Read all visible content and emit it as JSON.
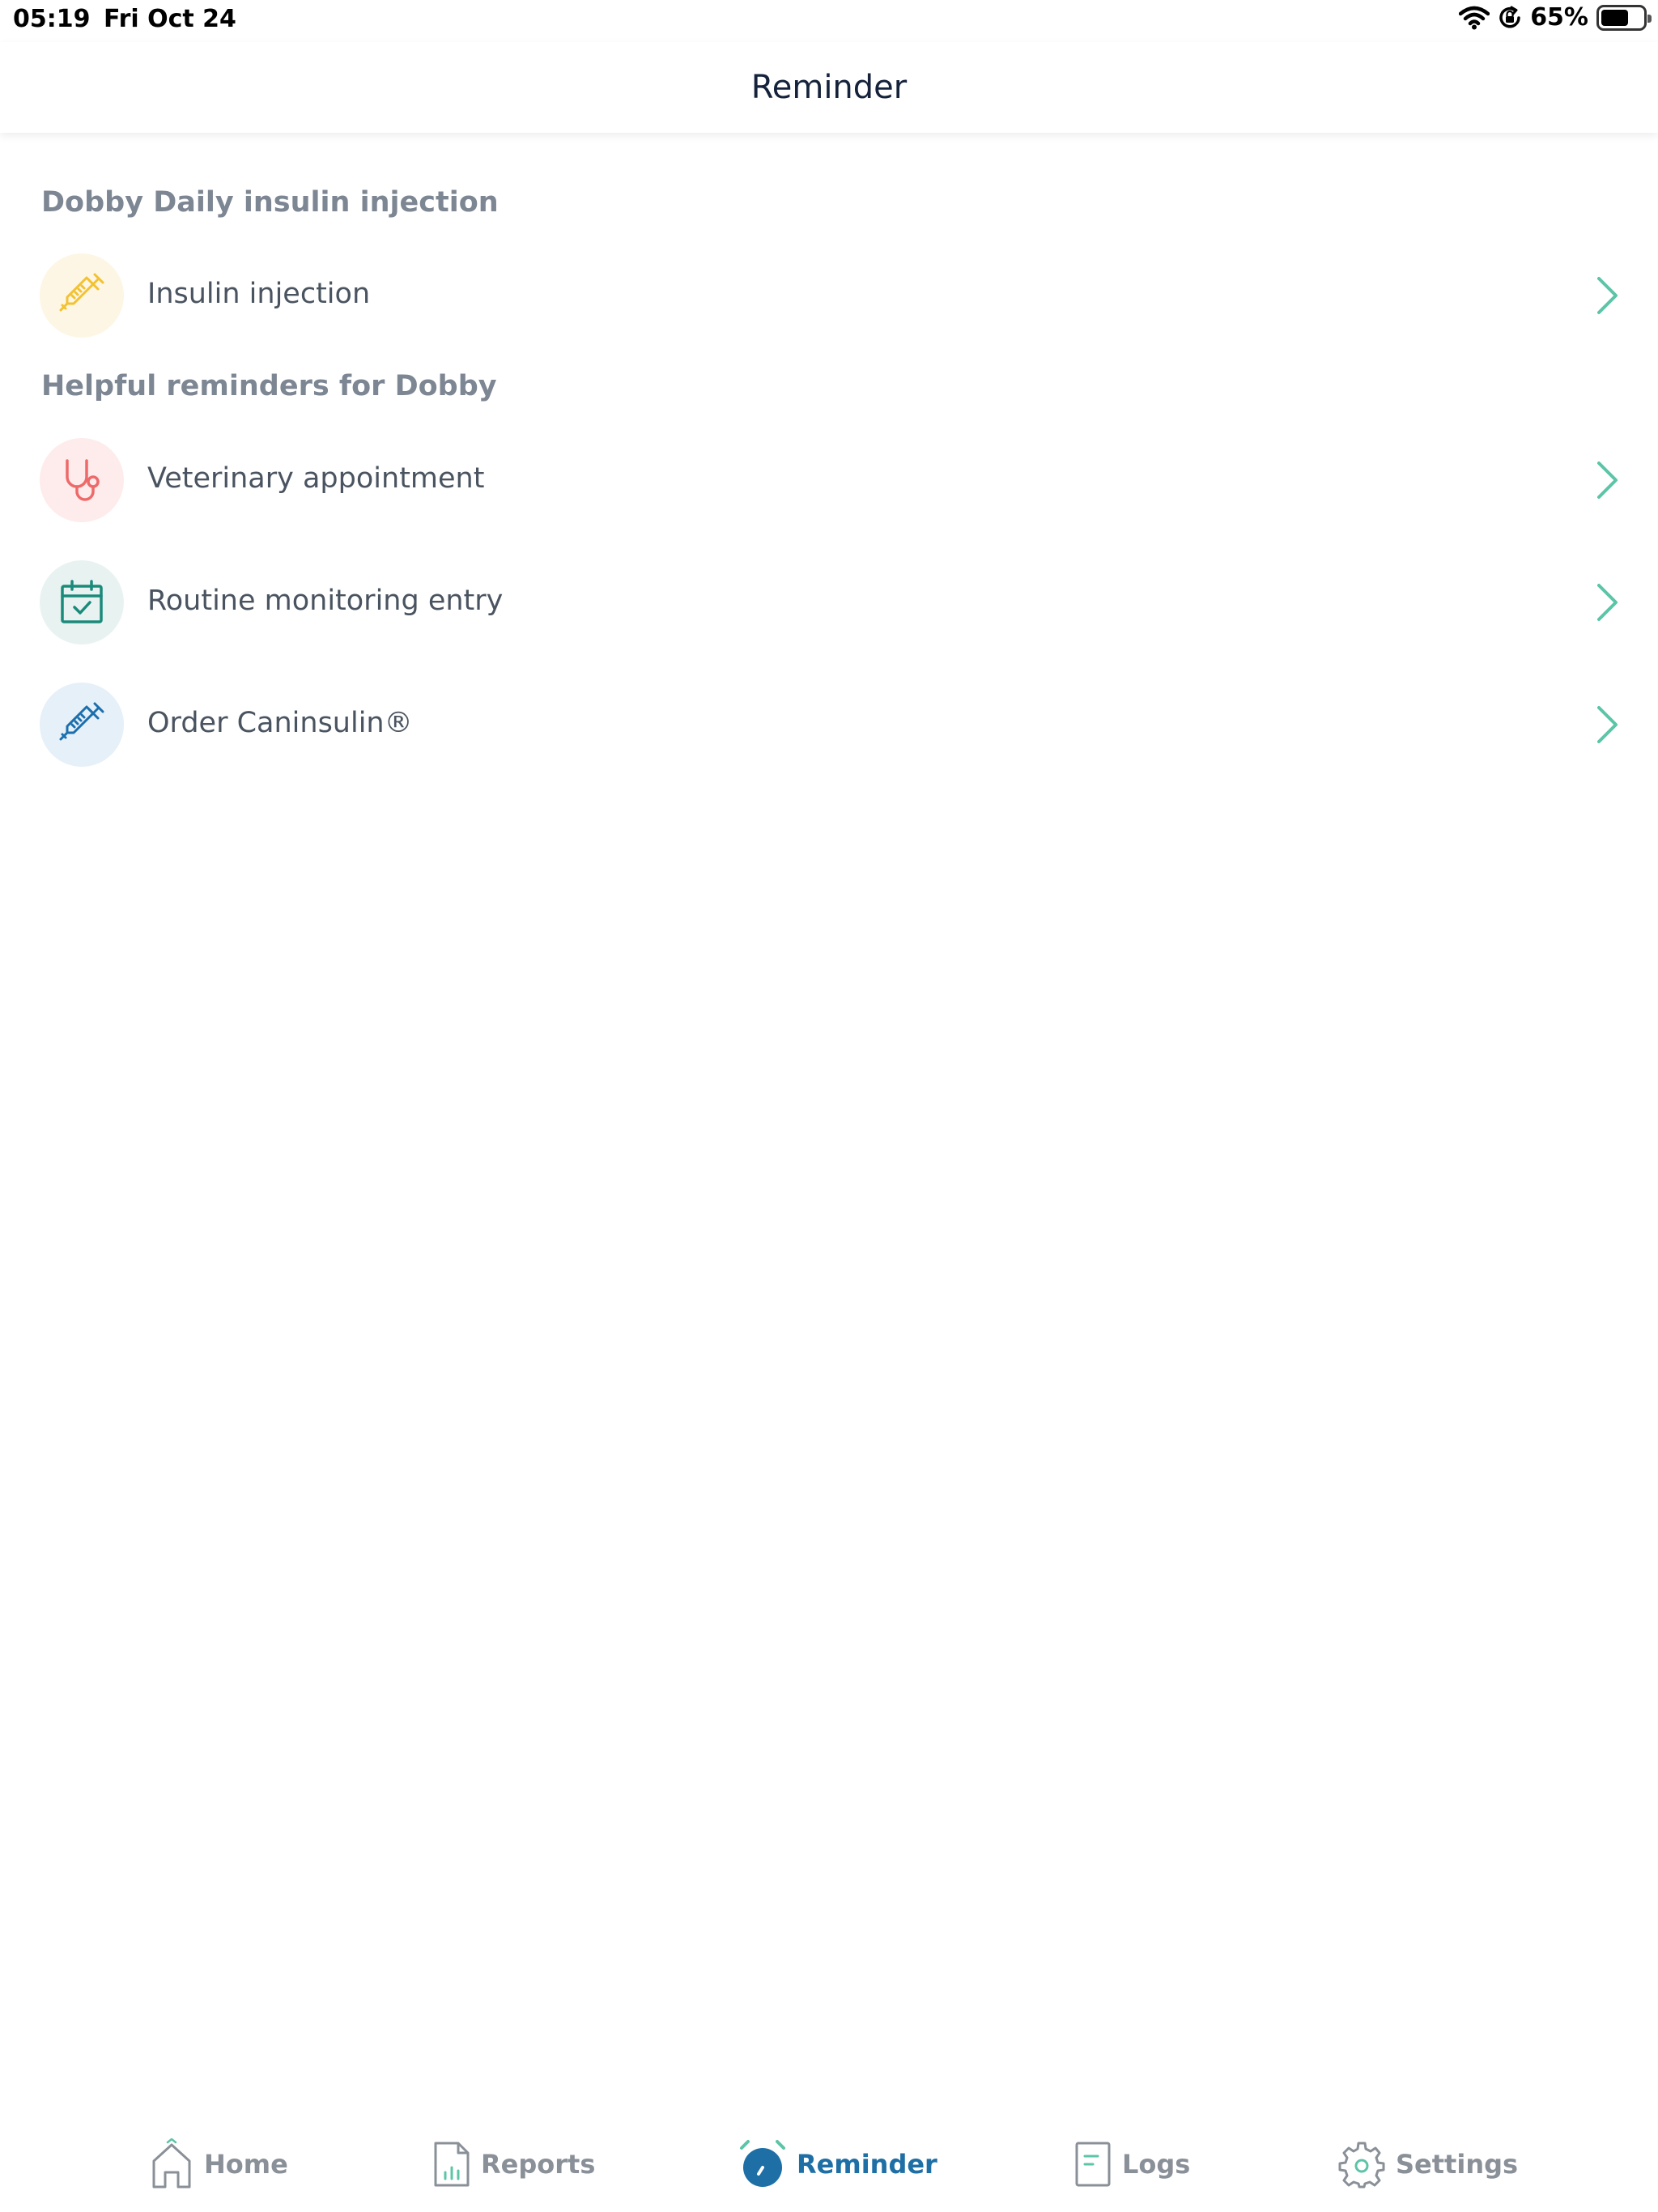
{
  "status_bar": {
    "time": "05:19",
    "date": "Fri Oct 24",
    "battery": "65%",
    "battery_level": 0.65,
    "icons": [
      "wifi-icon",
      "orientation-lock-icon",
      "battery-icon"
    ]
  },
  "nav": {
    "title": "Reminder"
  },
  "sections": [
    {
      "header": "Dobby Daily insulin injection",
      "items": [
        {
          "label": "Insulin injection",
          "icon": "syringe-icon",
          "icon_color": "#f2c230",
          "icon_bg": "#fdf6e4"
        }
      ]
    },
    {
      "header": "Helpful reminders for Dobby",
      "items": [
        {
          "label": "Veterinary appointment",
          "icon": "stethoscope-icon",
          "icon_color": "#ee6a6a",
          "icon_bg": "#fdeceb"
        },
        {
          "label": "Routine monitoring entry",
          "icon": "calendar-check-icon",
          "icon_color": "#1a8a7a",
          "icon_bg": "#e8f3f1"
        },
        {
          "label": "Order Caninsulin®",
          "icon": "syringe-icon",
          "icon_color": "#1c6fad",
          "icon_bg": "#e6f0f8"
        }
      ]
    }
  ],
  "tabs": [
    {
      "label": "Home",
      "icon": "home-icon",
      "active": false
    },
    {
      "label": "Reports",
      "icon": "report-icon",
      "active": false
    },
    {
      "label": "Reminder",
      "icon": "alarm-clock-icon",
      "active": true
    },
    {
      "label": "Logs",
      "icon": "logbook-icon",
      "active": false
    },
    {
      "label": "Settings",
      "icon": "gear-icon",
      "active": false
    }
  ],
  "colors": {
    "chevron": "#5cc4a7",
    "active_tab": "#1d6fa5",
    "inactive_tab": "#8a9098",
    "section_header": "#7d8693"
  }
}
